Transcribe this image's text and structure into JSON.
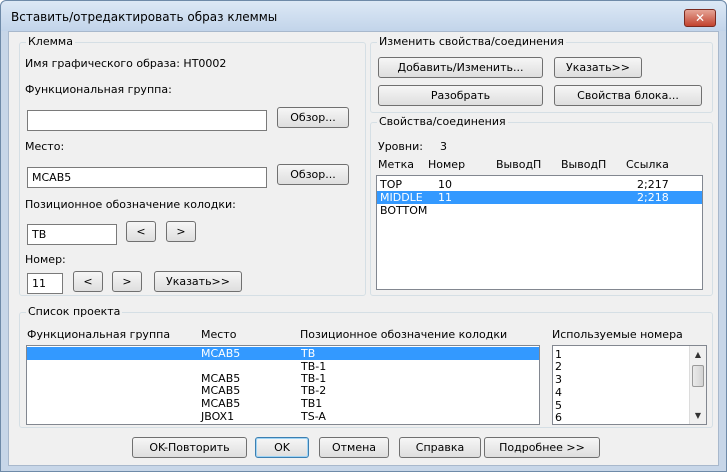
{
  "window": {
    "title": "Вставить/отредактировать образ клеммы",
    "close_glyph": "✕"
  },
  "terminal": {
    "group_title": "Клемма",
    "graphic_name_label": "Имя графического образа: НТ0002",
    "func_group_label": "Функциональная группа:",
    "func_group_value": "",
    "browse1_label": "Обзор...",
    "location_label": "Место:",
    "location_value": "MCAB5",
    "browse2_label": "Обзор...",
    "block_tag_label": "Позиционное обозначение колодки:",
    "block_tag_value": "TB",
    "prev_label": "<",
    "next_label": ">",
    "number_label": "Номер:",
    "number_value": "11",
    "num_prev_label": "<",
    "num_next_label": ">",
    "pick_label": "Указать>>"
  },
  "props_change": {
    "group_title": "Изменить свойства/соединения",
    "add_edit_label": "Добавить/Изменить...",
    "pick_label": "Указать>>",
    "explode_label": "Разобрать",
    "block_props_label": "Свойства блока..."
  },
  "props": {
    "group_title": "Свойства/соединения",
    "levels_label": "Уровни:",
    "levels_value": "3",
    "columns": [
      "Метка",
      "Номер",
      "ВыводП",
      "ВыводП",
      "Ссылка"
    ],
    "rows": [
      {
        "label": "TOP",
        "number": "10",
        "pin1": "",
        "pin2": "",
        "ref": "2;217",
        "selected": false
      },
      {
        "label": "MIDDLE",
        "number": "11",
        "pin1": "",
        "pin2": "",
        "ref": "2;218",
        "selected": true
      },
      {
        "label": "BOTTOM",
        "number": "",
        "pin1": "",
        "pin2": "",
        "ref": "",
        "selected": false
      }
    ]
  },
  "project": {
    "group_title": "Список проекта",
    "columns": [
      "Функциональная группа",
      "Место",
      "Позиционное обозначение колодки"
    ],
    "used_numbers_label": "Используемые номера",
    "rows": [
      {
        "group": "",
        "location": "MCAB5",
        "tag": "TB",
        "selected": true
      },
      {
        "group": "",
        "location": "",
        "tag": "TB-1",
        "selected": false
      },
      {
        "group": "",
        "location": "MCAB5",
        "tag": "TB-1",
        "selected": false
      },
      {
        "group": "",
        "location": "MCAB5",
        "tag": "TB-2",
        "selected": false
      },
      {
        "group": "",
        "location": "MCAB5",
        "tag": "TB1",
        "selected": false
      },
      {
        "group": "",
        "location": "JBOX1",
        "tag": "TS-A",
        "selected": false
      }
    ],
    "used_numbers": [
      "1",
      "2",
      "3",
      "4",
      "5",
      "6"
    ]
  },
  "footer": {
    "ok_repeat_label": "OK-Повторить",
    "ok_label": "OK",
    "cancel_label": "Отмена",
    "help_label": "Справка",
    "details_label": "Подробнее >>"
  },
  "colors": {
    "selection": "#3399ff",
    "dialog_bg": "#f0f0f0",
    "frame": "#c7d6e8",
    "close_red": "#c2432e"
  }
}
